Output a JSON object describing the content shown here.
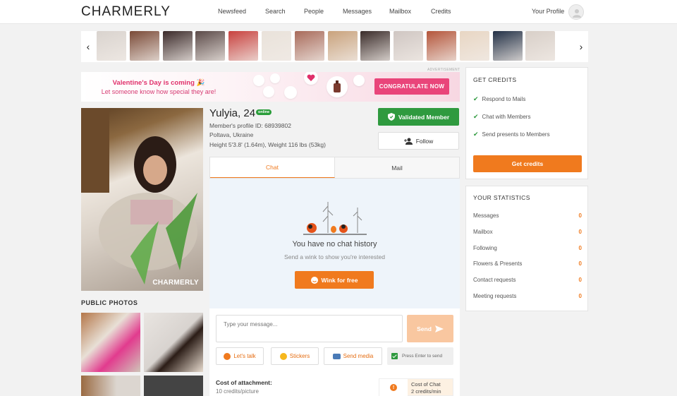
{
  "header": {
    "logo": "CHARMERLY",
    "nav": [
      "Newsfeed",
      "Search",
      "People",
      "Messages",
      "Mailbox",
      "Credits"
    ],
    "profile_label": "Your Profile"
  },
  "carousel": {
    "prev_icon": "chevron-left-icon",
    "next_icon": "chevron-right-icon",
    "thumb_colors": [
      "#d9d3ce",
      "#7a4a37",
      "#3b2a2a",
      "#5b4a48",
      "#c8413e",
      "#e9e2da",
      "#a86a5a",
      "#c9a27c",
      "#3a2c2a",
      "#cfc6c2",
      "#b4553a",
      "#e8d6c3",
      "#223046",
      "#d8cfc8"
    ]
  },
  "banner": {
    "ad_label": "ADVERTISEMENT",
    "line1": "Valentine's Day is coming 🎉",
    "line2": "Let someone know how special they are!",
    "button": "CONGRATULATE NOW"
  },
  "profile": {
    "name_age": "Yulyia, 24",
    "status": "online",
    "id_line": "Member's profile ID: 68939802",
    "location": "Poltava, Ukraine",
    "body": "Height 5'3.8' (1.64m), Weight 116 lbs (53kg)",
    "photo_watermark": "CHARMERLY",
    "validated_label": "Validated Member",
    "follow_label": "Follow",
    "public_photos_title": "PUBLIC PHOTOS"
  },
  "chat": {
    "tabs": [
      "Chat",
      "Mail"
    ],
    "empty_title": "You have no chat history",
    "empty_hint": "Send a wink to show you're interested",
    "wink_button": "Wink for free",
    "input_placeholder": "Type your message...",
    "send_label": "Send",
    "lets_talk": "Let's talk",
    "stickers": "Stickers",
    "send_media": "Send media",
    "press_enter": "Press Enter to send",
    "cost_title": "Cost of attachment:",
    "cost_sub": "10 credits/picture",
    "cost_chat_label": "Cost of Chat",
    "cost_chat_value": "2 credits/min"
  },
  "credits_panel": {
    "title": "GET CREDITS",
    "items": [
      "Respond to Mails",
      "Chat with Members",
      "Send presents to Members"
    ],
    "button": "Get credits"
  },
  "stats_panel": {
    "title": "YOUR STATISTICS",
    "rows": [
      {
        "label": "Messages",
        "value": "0"
      },
      {
        "label": "Mailbox",
        "value": "0"
      },
      {
        "label": "Following",
        "value": "0"
      },
      {
        "label": "Flowers & Presents",
        "value": "0"
      },
      {
        "label": "Contact requests",
        "value": "0"
      },
      {
        "label": "Meeting requests",
        "value": "0"
      }
    ]
  },
  "colors": {
    "accent": "#f07a1e",
    "green": "#2f9a3f",
    "banner_pink": "#e9457a"
  }
}
